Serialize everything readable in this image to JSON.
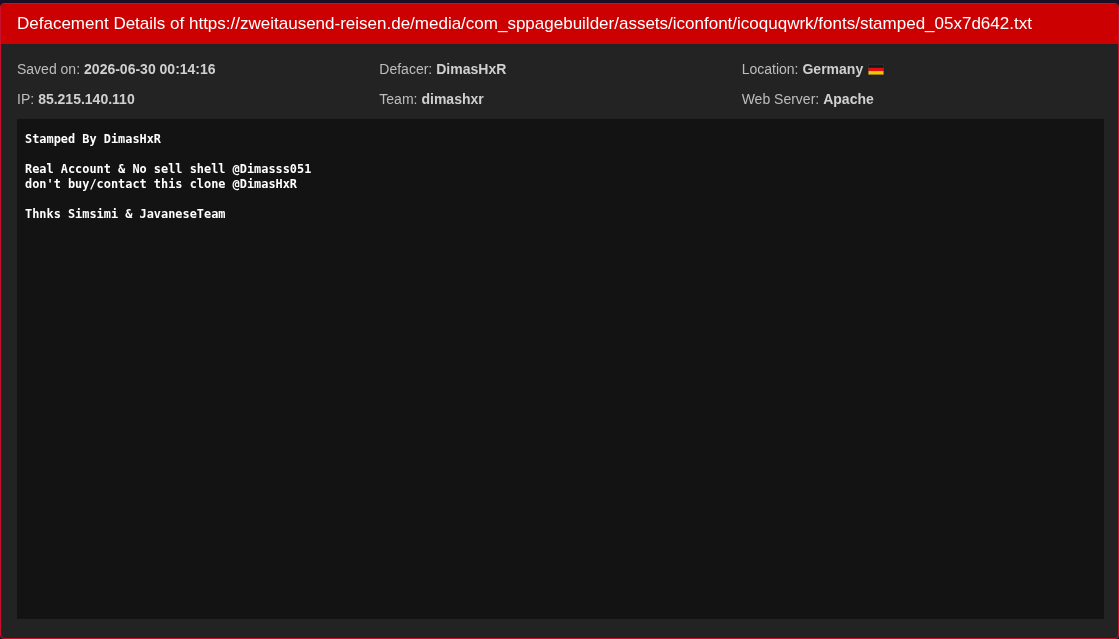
{
  "header": {
    "title": "Defacement Details of https://zweitausend-reisen.de/media/com_sppagebuilder/assets/iconfont/icoquqwrk/fonts/stamped_05x7d642.txt"
  },
  "details": [
    {
      "kind": "text",
      "label": "Saved on:",
      "value": "2026-06-30 00:14:16"
    },
    {
      "kind": "text",
      "label": "Defacer:",
      "value": "DimasHxR"
    },
    {
      "kind": "flag",
      "label": "Location:",
      "value": "Germany"
    },
    {
      "kind": "text",
      "label": "IP:",
      "value": "85.215.140.110"
    },
    {
      "kind": "text",
      "label": "Team:",
      "value": "dimashxr"
    },
    {
      "kind": "text",
      "label": "Web Server:",
      "value": "Apache"
    }
  ],
  "mirror": {
    "paragraphs": [
      [
        "Stamped By DimasHxR"
      ],
      [
        "Real Account & No sell shell @Dimasss051",
        "don't buy/contact this clone @DimasHxR"
      ],
      [
        "Thnks Simsimi & JavaneseTeam"
      ]
    ]
  }
}
